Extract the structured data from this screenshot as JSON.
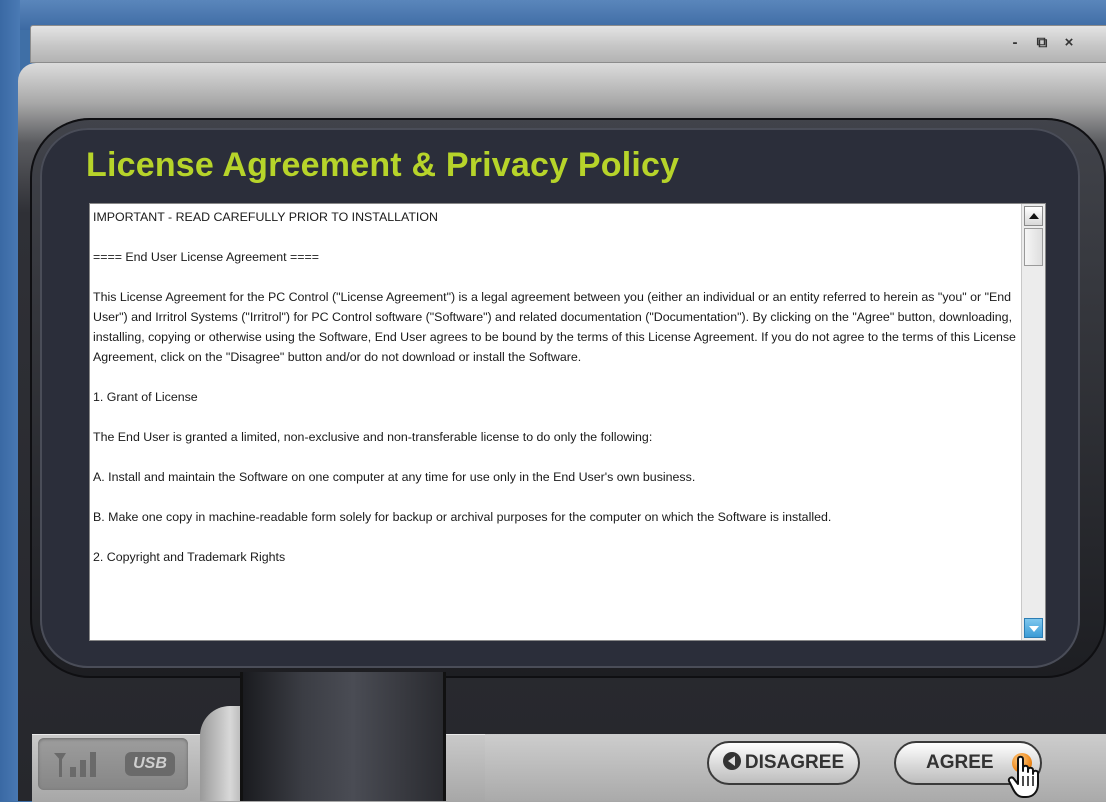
{
  "window": {
    "controls": {
      "minimize": "-",
      "restore": "⧉",
      "close": "×"
    }
  },
  "license": {
    "title": "License Agreement & Privacy Policy",
    "paragraphs": [
      "IMPORTANT - READ CAREFULLY PRIOR TO INSTALLATION",
      "==== End User License Agreement ====",
      "This License Agreement for the PC Control (\"License Agreement\") is a legal agreement between you (either an individual or an entity referred to herein as \"you\" or \"End User\") and Irritrol Systems (\"Irritrol\") for PC Control software (\"Software\") and related documentation (\"Documentation\"). By clicking on the \"Agree\" button, downloading, installing, copying or otherwise using the Software, End User agrees to be bound by the terms of this License Agreement. If you do not agree to the terms of this License Agreement, click on the \"Disagree\" button and/or do not download or install the Software.",
      "1. Grant of License",
      "The End User is granted a limited, non-exclusive and non-transferable license to do only the following:",
      "A. Install and maintain the Software on one computer at any time for use only in the End User's own business.",
      "B. Make one copy in machine-readable form solely for backup or archival purposes for the computer on which the Software is installed.",
      "2. Copyright and Trademark Rights"
    ]
  },
  "status": {
    "usb_label": "USB"
  },
  "buttons": {
    "disagree": "DISAGREE",
    "agree": "AGREE"
  },
  "colors": {
    "title": "#b7d42a",
    "desktop": "#3f6fa6",
    "accent_orange": "#f08a1c"
  },
  "icons": [
    "signal-strength-icon",
    "usb-icon",
    "back-arrow-icon",
    "hand-cursor-icon",
    "scroll-up-icon",
    "scroll-down-icon"
  ]
}
